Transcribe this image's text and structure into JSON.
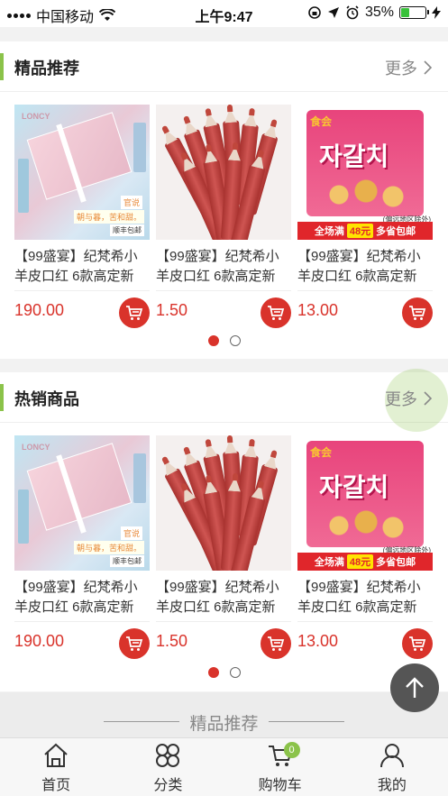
{
  "status_bar": {
    "carrier": "中国移动",
    "time": "上午9:47",
    "battery_percent": "35%",
    "battery_level": 0.35,
    "icons": [
      "signal-icon",
      "wifi-icon",
      "lock-rotation-icon",
      "location-icon",
      "alarm-icon",
      "battery-icon",
      "charging-icon"
    ]
  },
  "sections": [
    {
      "title": "精品推荐",
      "more": "更多",
      "products": [
        {
          "name": "【99盛宴】纪梵希小羊皮口红 6款高定新",
          "price": "190.00",
          "image": "lipstick-gift-box",
          "image_text": {
            "brand": "LONCY",
            "tag1": "官说",
            "tag2": "朝与暮，苦和甜。",
            "tag3": "顺丰包邮"
          }
        },
        {
          "name": "【99盛宴】纪梵希小羊皮口红 6款高定新",
          "price": "1.50",
          "image": "lip-pencils"
        },
        {
          "name": "【99盛宴】纪梵希小羊皮口红 6款高定新",
          "price": "13.00",
          "image": "snack-bag",
          "image_text": {
            "logo": "食会",
            "korean": "자갈치",
            "note": "(偏远地区除外)",
            "banner_a": "全场满",
            "banner_b": "48元",
            "banner_c": "多省包邮"
          }
        }
      ],
      "page_count": 2,
      "active_page": 0
    },
    {
      "title": "热销商品",
      "more": "更多",
      "products": [
        {
          "name": "【99盛宴】纪梵希小羊皮口红 6款高定新",
          "price": "190.00",
          "image": "lipstick-gift-box",
          "image_text": {
            "brand": "LONCY",
            "tag1": "官说",
            "tag2": "朝与暮，苦和甜。",
            "tag3": "顺丰包邮"
          }
        },
        {
          "name": "【99盛宴】纪梵希小羊皮口红 6款高定新",
          "price": "1.50",
          "image": "lip-pencils"
        },
        {
          "name": "【99盛宴】纪梵希小羊皮口红 6款高定新",
          "price": "13.00",
          "image": "snack-bag",
          "image_text": {
            "logo": "食会",
            "korean": "자갈치",
            "note": "(偏远地区除外)",
            "banner_a": "全场满",
            "banner_b": "48元",
            "banner_c": "多省包邮"
          }
        }
      ],
      "page_count": 2,
      "active_page": 0
    }
  ],
  "recommend_divider": "精品推荐",
  "tabbar": {
    "items": [
      {
        "label": "首页",
        "icon": "home-icon"
      },
      {
        "label": "分类",
        "icon": "category-icon"
      },
      {
        "label": "购物车",
        "icon": "cart-icon",
        "badge": "0"
      },
      {
        "label": "我的",
        "icon": "user-icon"
      }
    ]
  },
  "colors": {
    "accent_green": "#8bc34a",
    "price_red": "#d9332b"
  }
}
